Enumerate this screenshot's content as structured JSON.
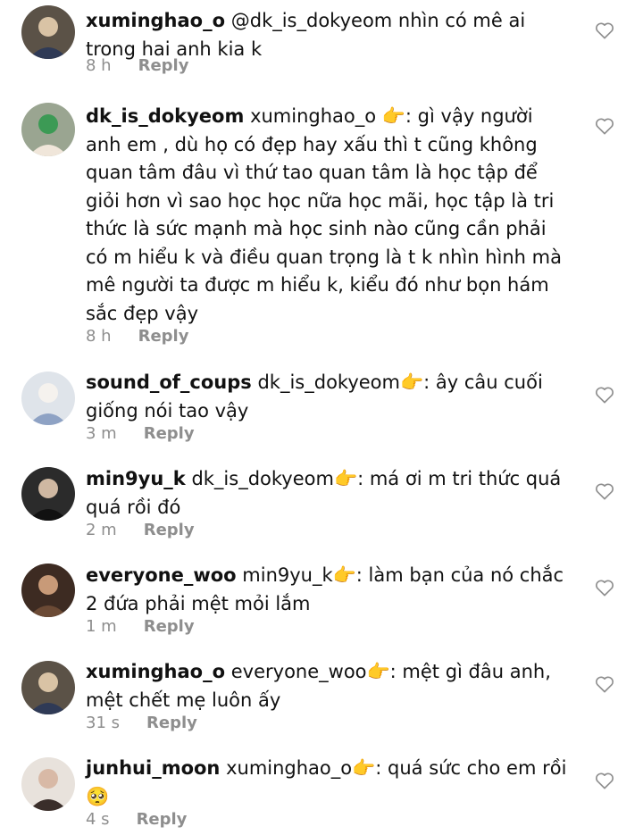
{
  "comments": [
    {
      "username": "xuminghao_o",
      "text": "@dk_is_dokyeom nhìn có mê ai trong hai anh kia k",
      "time": "8 h",
      "reply_label": "Reply",
      "avatar_colors": [
        "#5b5247",
        "#d9c3a5",
        "#2f3a56"
      ]
    },
    {
      "username": "dk_is_dokyeom",
      "text": "xuminghao_o 👉: gì vậy người anh em , dù họ có đẹp hay xấu thì t cũng không quan tâm đâu vì thứ tao quan tâm là học tập để giỏi hơn vì sao học học nữa học mãi, học tập là tri thức là sức mạnh mà học sinh nào cũng cần phải có m hiểu k và điều quan trọng là t k nhìn hình mà mê người ta được m hiểu k, kiểu đó như bọn hám sắc đẹp vậy",
      "time": "8 h",
      "reply_label": "Reply",
      "avatar_colors": [
        "#9aa591",
        "#3c9a55",
        "#f0e6da"
      ]
    },
    {
      "username": "sound_of_coups",
      "text": "dk_is_dokyeom👉: ây câu cuối giống nói tao vậy",
      "time": "3 m",
      "reply_label": "Reply",
      "avatar_colors": [
        "#dfe4ea",
        "#f5f2ee",
        "#8ea2c4"
      ]
    },
    {
      "username": "min9yu_k",
      "text": "dk_is_dokyeom👉: má ơi m tri thức quá quá rồi đó",
      "time": "2 m",
      "reply_label": "Reply",
      "avatar_colors": [
        "#2b2b2b",
        "#cfb8a2",
        "#111111"
      ]
    },
    {
      "username": "everyone_woo",
      "text": "min9yu_k👉: làm bạn của nó chắc 2 đứa phải mệt mỏi lắm",
      "time": "1 m",
      "reply_label": "Reply",
      "avatar_colors": [
        "#3d2b22",
        "#c89a78",
        "#6b4a35"
      ]
    },
    {
      "username": "xuminghao_o",
      "text": "everyone_woo👉: mệt gì đâu anh, mệt chết mẹ luôn ấy",
      "time": "31 s",
      "reply_label": "Reply",
      "avatar_colors": [
        "#5b5247",
        "#d9c3a5",
        "#2f3a56"
      ]
    },
    {
      "username": "junhui_moon",
      "text": "xuminghao_o👉: quá sức cho em rồi 🥺",
      "time": "4 s",
      "reply_label": "Reply",
      "avatar_colors": [
        "#e8e2dc",
        "#d8b9a6",
        "#3a2e2a"
      ]
    }
  ],
  "icons": {
    "like": "heart-outline-icon"
  },
  "colors": {
    "meta_text": "#8e8e8e",
    "heart_stroke": "#8e8e8e"
  }
}
